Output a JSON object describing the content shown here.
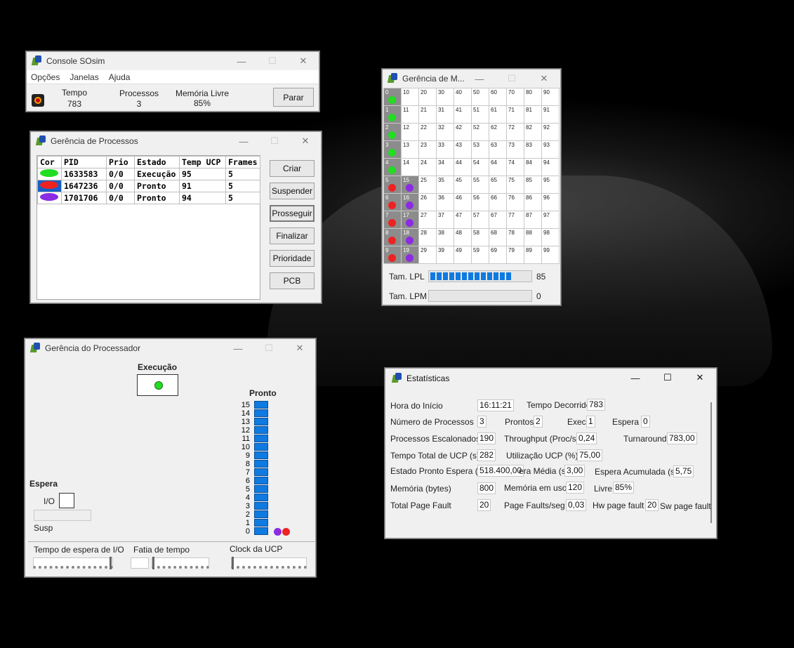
{
  "console": {
    "title": "Console SOsim",
    "menu": [
      "Opções",
      "Janelas",
      "Ajuda"
    ],
    "tempo_label": "Tempo",
    "tempo": "783",
    "processos_label": "Processos",
    "processos": "3",
    "memoria_label": "Memória Livre",
    "memoria": "85%",
    "parar": "Parar"
  },
  "processos": {
    "title": "Gerência de Processos",
    "headers": [
      "Cor",
      "PID",
      "Prio",
      "Estado",
      "Temp UCP",
      "Frames"
    ],
    "rows": [
      {
        "cor": "#22dd22",
        "pid": "1633583",
        "prio": "0/0",
        "estado": "Execução",
        "temp": "95",
        "frames": "5"
      },
      {
        "cor": "#ee2222",
        "pid": "1647236",
        "prio": "0/0",
        "estado": "Pronto",
        "temp": "91",
        "frames": "5"
      },
      {
        "cor": "#8b2be2",
        "pid": "1701706",
        "prio": "0/0",
        "estado": "Pronto",
        "temp": "94",
        "frames": "5"
      }
    ],
    "buttons": {
      "criar": "Criar",
      "suspender": "Suspender",
      "prosseguir": "Prosseguir",
      "finalizar": "Finalizar",
      "prioridade": "Prioridade",
      "pcb": "PCB"
    }
  },
  "memoria": {
    "title": "Gerência de M...",
    "lpl_label": "Tam. LPL",
    "lpl_value": "85",
    "lpl_fill": 0.85,
    "lpm_label": "Tam. LPM",
    "lpm_value": "0",
    "lpm_fill": 0,
    "used_frames": {
      "0": "#22dd22",
      "1": "#22dd22",
      "2": "#22dd22",
      "3": "#22dd22",
      "4": "#22dd22",
      "5": "#ee2222",
      "6": "#ee2222",
      "7": "#ee2222",
      "8": "#ee2222",
      "9": "#ee2222",
      "15": "#8b2be2",
      "16": "#8b2be2",
      "17": "#8b2be2",
      "18": "#8b2be2",
      "19": "#8b2be2"
    }
  },
  "processador": {
    "title": "Gerência do Processador",
    "execucao": "Execução",
    "pronto": "Pronto",
    "espera": "Espera",
    "io": "I/O",
    "susp": "Susp",
    "queue_labels": [
      "15",
      "14",
      "13",
      "12",
      "11",
      "10",
      "9",
      "8",
      "7",
      "6",
      "5",
      "4",
      "3",
      "2",
      "1",
      "0"
    ],
    "ready_dots": [
      "#8b2be2",
      "#ee2222"
    ],
    "running_color": "#22dd22",
    "tempo_espera": "Tempo de espera de I/O",
    "fatia": "Fatia de tempo",
    "clock": "Clock da UCP"
  },
  "estatisticas": {
    "title": "Estatísticas",
    "hora_label": "Hora do Início",
    "hora": "16:11:21",
    "decorrido_label": "Tempo Decorrido",
    "decorrido": "783",
    "num_label": "Número de Processos",
    "num": "3",
    "prontos_label": "Prontos",
    "prontos": "2",
    "exec_label": "Exec",
    "exec": "1",
    "espera_label": "Espera",
    "espera": "0",
    "escal_label": "Processos Escalonados",
    "escal": "190",
    "through_label": "Throughput (Proc/s)",
    "through": "0,24",
    "turn_label": "Turnaround",
    "turn": "783,00",
    "ucp_label": "Tempo Total de UCP (s)",
    "ucp": "282",
    "util_label": "Utilização UCP (%)",
    "util": "75,00",
    "estado_label": "Estado Pronto Espera (s)",
    "estado": "518.400,00",
    "media_label": "era Média (s)",
    "media": "3,00",
    "acum_label": "Espera Acumulada (s)",
    "acum": "5,75",
    "mem_label": "Memória (bytes)",
    "mem": "800",
    "uso_label": "Memória em uso",
    "uso": "120",
    "livre_label": "Livre",
    "livre": "85%",
    "tpf_label": "Total Page Fault",
    "tpf": "20",
    "pfs_label": "Page Faults/seg",
    "pfs": "0,03",
    "hw_label": "Hw page fault",
    "hw": "20",
    "sw_label": "Sw page fault"
  }
}
